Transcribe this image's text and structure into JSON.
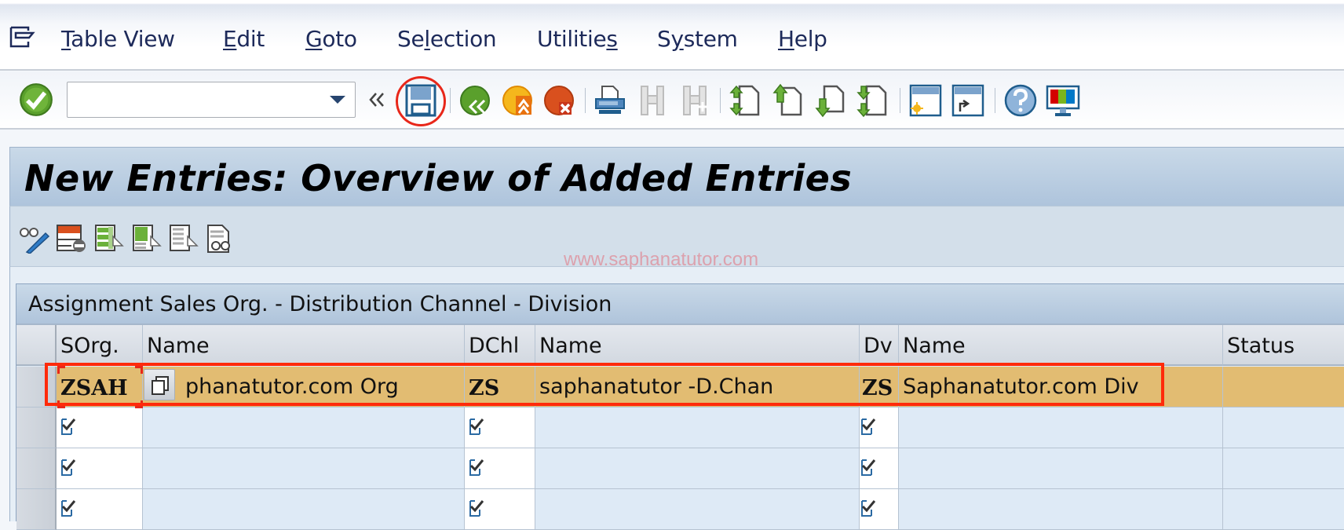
{
  "menubar": {
    "icon": "menu-list-icon",
    "items": [
      {
        "label": "Table View",
        "mnemonic_index": 0
      },
      {
        "label": "Edit",
        "mnemonic_index": 0
      },
      {
        "label": "Goto",
        "mnemonic_index": 0
      },
      {
        "label": "Selection",
        "mnemonic_index": 2
      },
      {
        "label": "Utilities",
        "mnemonic_index": 8
      },
      {
        "label": "System",
        "mnemonic_index": 1
      },
      {
        "label": "Help",
        "mnemonic_index": 0
      }
    ]
  },
  "system_toolbar": {
    "enter_icon": "green-check-enter-icon",
    "command_field": {
      "value": "",
      "placeholder": ""
    },
    "collapse_icon": "double-chevron-left-icon",
    "buttons": [
      {
        "name": "save",
        "icon": "floppy-save-icon",
        "highlighted": true
      },
      {
        "name": "back",
        "icon": "green-back-icon"
      },
      {
        "name": "exit",
        "icon": "orange-exit-icon"
      },
      {
        "name": "cancel",
        "icon": "red-cancel-icon"
      },
      {
        "name": "print",
        "icon": "printer-icon"
      },
      {
        "name": "find",
        "icon": "binoculars-icon",
        "disabled": true
      },
      {
        "name": "find-next",
        "icon": "binoculars-plus-icon",
        "disabled": true
      },
      {
        "name": "first-page",
        "icon": "first-page-icon"
      },
      {
        "name": "previous-page",
        "icon": "previous-page-icon"
      },
      {
        "name": "next-page",
        "icon": "next-page-icon"
      },
      {
        "name": "last-page",
        "icon": "last-page-icon"
      },
      {
        "name": "create-session",
        "icon": "new-session-icon"
      },
      {
        "name": "create-shortcut",
        "icon": "shortcut-icon"
      },
      {
        "name": "help",
        "icon": "help-icon"
      },
      {
        "name": "customize-layout",
        "icon": "monitor-colors-icon"
      }
    ]
  },
  "page": {
    "title": "New Entries: Overview of Added Entries",
    "watermark": "www.saphanatutor.com",
    "app_toolbar": [
      {
        "name": "display-change",
        "icon": "glasses-pencil-icon"
      },
      {
        "name": "delete",
        "icon": "delete-row-icon"
      },
      {
        "name": "select-all",
        "icon": "select-all-icon"
      },
      {
        "name": "select-block",
        "icon": "select-block-icon"
      },
      {
        "name": "deselect-all",
        "icon": "deselect-all-icon"
      },
      {
        "name": "print-preview",
        "icon": "document-glasses-icon"
      }
    ]
  },
  "table": {
    "title": "Assignment Sales Org. - Distribution Channel - Division",
    "columns": [
      "SOrg.",
      "Name",
      "DChl",
      "Name",
      "Dv",
      "Name",
      "Status"
    ],
    "rows": [
      {
        "sorg": "ZSAH",
        "sorg_name": "phanatutor.com Org",
        "dchl": "ZS",
        "dchl_name": "saphanatutor -D.Chan",
        "dv": "ZS",
        "dv_name": "Saphanatutor.com Div",
        "status": "",
        "highlighted": true
      },
      {
        "sorg": "",
        "sorg_name": "",
        "dchl": "",
        "dchl_name": "",
        "dv": "",
        "dv_name": "",
        "status": ""
      },
      {
        "sorg": "",
        "sorg_name": "",
        "dchl": "",
        "dchl_name": "",
        "dv": "",
        "dv_name": "",
        "status": ""
      },
      {
        "sorg": "",
        "sorg_name": "",
        "dchl": "",
        "dchl_name": "",
        "dv": "",
        "dv_name": "",
        "status": ""
      }
    ]
  },
  "colors": {
    "highlight_row": "#e2bc72",
    "annotation_red": "#ff2a0a",
    "title_bar": "#aec4dc",
    "watermark": "#dca1ad"
  }
}
